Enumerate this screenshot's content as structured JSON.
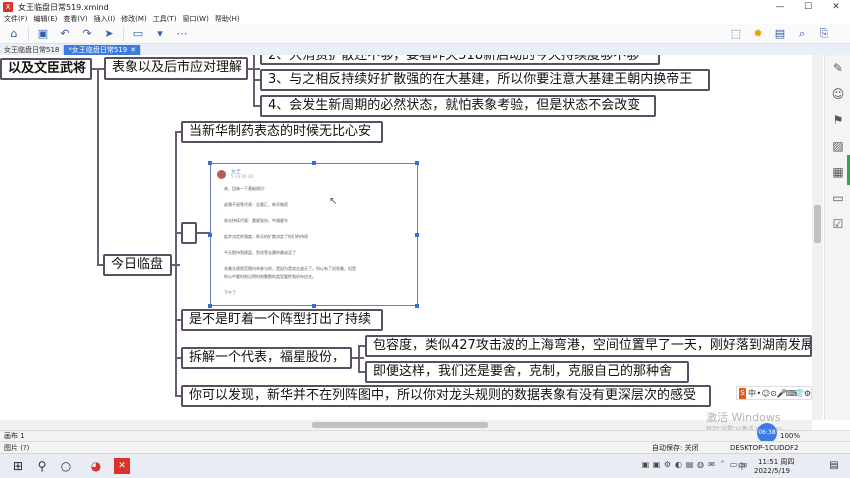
{
  "window": {
    "title": "女王临盘日常519.xmind",
    "app_icon_label": "X",
    "controls": [
      "—",
      "☐",
      "✕"
    ]
  },
  "menu": [
    "文件(F)",
    "编辑(E)",
    "查看(V)",
    "插入(I)",
    "修改(M)",
    "工具(T)",
    "窗口(W)",
    "帮助(H)"
  ],
  "toolbar": {
    "left_icons": [
      "home-icon",
      "save-icon",
      "undo-icon",
      "redo-icon",
      "pointer-icon",
      "topic-icon",
      "dropdown-icon",
      "more-icon"
    ],
    "right_icons": [
      "presentation-icon",
      "idea-icon",
      "layout-icon",
      "search-icon",
      "export-icon"
    ]
  },
  "tabs": [
    {
      "label": "女王临盘日常518",
      "active": false
    },
    {
      "label": "*女王临盘日常519",
      "active": true,
      "close": "✕"
    }
  ],
  "mindmap": {
    "root": "以及文臣武将",
    "branch_a": "表象以及后市应对理解",
    "items_a": [
      "2、大消费扩散还不够，要看昨天518新启动的今天持续度够不够",
      "3、与之相反持续好扩散强的在大基建，所以你要注意大基建王朝内换帝王",
      "4、会发生新周期的必然状态，就怕表象考验，但是状态不会改变"
    ],
    "today": "今日临盘",
    "today_items": {
      "first": "当新华制药表态的时候无比心安",
      "second": "是不是盯着一个阵型打出了持续",
      "third": "拆解一个代表，福星股份，",
      "third_children": [
        "包容度，类似427攻击波的上海弯港，空间位置早了一天，刚好落到湖南发展",
        "即便这样，我们还是要舍，克制，克服自己的那种舍"
      ],
      "fourth": "你可以发现，新华并不在列阵图中，所以你对龙头规则的数据表象有没有更深层次的感受"
    },
    "note_image": {
      "name": "女王",
      "sub": "5-19 09:38",
      "lines": [
        "来，回味一下基础知识：",
        "退潮不退等代表：业委汇、新华制药",
        "攻击持续代表：雷星股份、中通客车",
        "起步决定的强度，昨天的扩散决定了你们的持续",
        "今天肥持到顾盘，到浓等去晨你最成没了",
        "非美头规则范围内命参与的，是因为是攻击波天了，所以有了初吞着，但是",
        "你心中要时刻记得时刻繁数的类型要性和机布应式。",
        "下午了"
      ]
    }
  },
  "side_panel_icons": [
    "brush-icon",
    "marker-icon",
    "flag-icon",
    "image-icon",
    "library-icon",
    "comment-icon",
    "task-icon"
  ],
  "ime_bar": {
    "logo": "S",
    "icons": [
      "中",
      "•",
      "☺",
      "⊙",
      "🎤",
      "⌨",
      "👕",
      "⚙"
    ]
  },
  "status": {
    "sheet": "画布 1",
    "left": "图片 (?)",
    "autosave": "自动保存: 关闭",
    "computer": "DESKTOP-1CUDOF2",
    "zoom_badge": "06:38",
    "zoom_level": "100%"
  },
  "watermark": {
    "line1": "激活 Windows",
    "line2": "转到\"设置\"以激活 Windows。"
  },
  "taskbar": {
    "time": "11:51 周四",
    "date": "2022/5/19",
    "ime": "中",
    "apps": [
      "windows-start-icon",
      "search-icon",
      "task-view-icon",
      "browser-icon",
      "xmind-icon"
    ]
  }
}
